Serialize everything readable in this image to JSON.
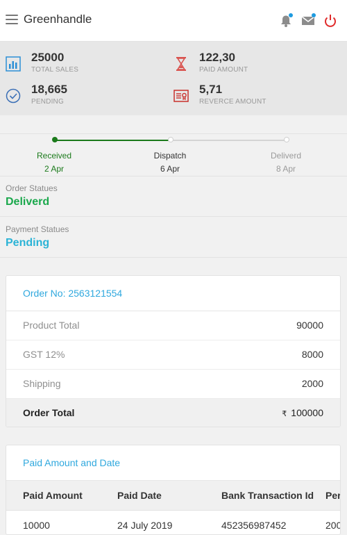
{
  "header": {
    "app_title": "Greenhandle",
    "icons": [
      "menu-icon",
      "bell-icon",
      "mail-icon",
      "power-icon"
    ]
  },
  "stats": [
    {
      "value": "25000",
      "label": "TOTAL SALES",
      "icon": "bar-chart-icon",
      "color": "#2b8fd6"
    },
    {
      "value": "122,30",
      "label": "PAID AMOUNT",
      "icon": "hourglass-icon",
      "color": "#d9534f"
    },
    {
      "value": "18,665",
      "label": "PENDING",
      "icon": "check-circle-icon",
      "color": "#3b6fb6"
    },
    {
      "value": "5,71",
      "label": "REVERCE AMOUNT",
      "icon": "certificate-icon",
      "color": "#c9302c"
    }
  ],
  "tracker": {
    "steps": [
      {
        "label": "Received",
        "date": "2 Apr",
        "state": "done"
      },
      {
        "label": "Dispatch",
        "date": "6 Apr",
        "state": "current"
      },
      {
        "label": "Deliverd",
        "date": "8 Apr",
        "state": "pending"
      }
    ],
    "colors": {
      "done": "#1b7a1b",
      "pending": "#d0d0d0"
    }
  },
  "order_status": {
    "label": "Order Statues",
    "value": "Deliverd",
    "color": "#1aa84c"
  },
  "payment_status": {
    "label": "Payment Statues",
    "value": "Pending",
    "color": "#2bb3d6"
  },
  "order_card": {
    "title": "Order No: 2563121554",
    "rows": [
      {
        "label": "Product Total",
        "value": "90000"
      },
      {
        "label": "GST 12%",
        "value": "8000"
      },
      {
        "label": "Shipping",
        "value": "2000"
      }
    ],
    "total": {
      "label": "Order Total",
      "currency": "₹",
      "value": "100000"
    }
  },
  "paid_card": {
    "title": "Paid Amount and Date",
    "columns": [
      "Paid Amount",
      "Paid Date",
      "Bank Transaction Id",
      "Per"
    ],
    "rows": [
      [
        "10000",
        "24 July 2019",
        "452356987452",
        "200"
      ]
    ]
  }
}
